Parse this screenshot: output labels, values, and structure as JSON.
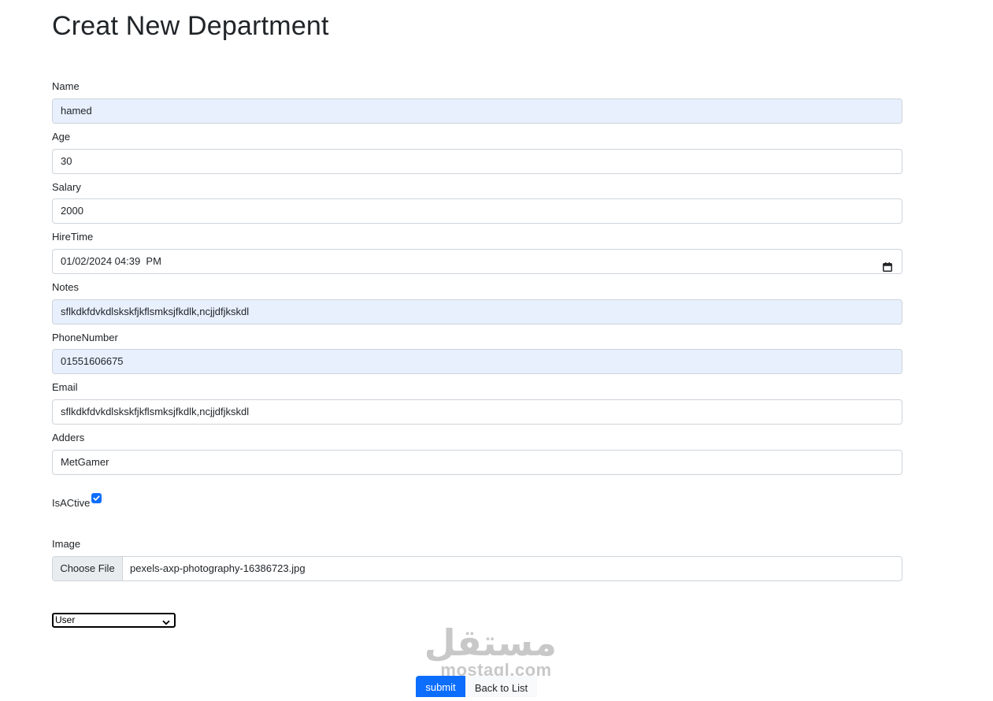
{
  "page": {
    "title": "Creat New Department"
  },
  "fields": {
    "name": {
      "label": "Name",
      "value": "hamed"
    },
    "age": {
      "label": "Age",
      "value": "30"
    },
    "salary": {
      "label": "Salary",
      "value": "2000"
    },
    "hiretime": {
      "label": "HireTime",
      "value": "01/02/2024 04:39  PM"
    },
    "notes": {
      "label": "Notes",
      "value": "sflkdkfdvkdlskskfjkflsmksjfkdlk,ncjjdfjkskdl"
    },
    "phone": {
      "label": "PhoneNumber",
      "value": "01551606675"
    },
    "email": {
      "label": "Email",
      "value": "sflkdkfdvkdlskskfjkflsmksjfkdlk,ncjjdfjkskdl"
    },
    "adders": {
      "label": "Adders",
      "value": "MetGamer"
    }
  },
  "isactive": {
    "label": "IsACtive",
    "checked": true
  },
  "image": {
    "label": "Image",
    "button_label": "Choose File",
    "file_name": "pexels-axp-photography-16386723.jpg"
  },
  "role_select": {
    "selected": "User"
  },
  "watermark": {
    "arabic": "مستقل",
    "latin": "mostaql.com"
  },
  "actions": {
    "submit_label": "submit",
    "back_label": "Back to List"
  },
  "colors": {
    "primary": "#0d6efd",
    "autofill": "#e8f0fe",
    "border": "#ced4da"
  },
  "icons": {
    "hiretime": "calendar-icon",
    "select": "chevron-down-icon",
    "checkbox": "check-icon"
  }
}
